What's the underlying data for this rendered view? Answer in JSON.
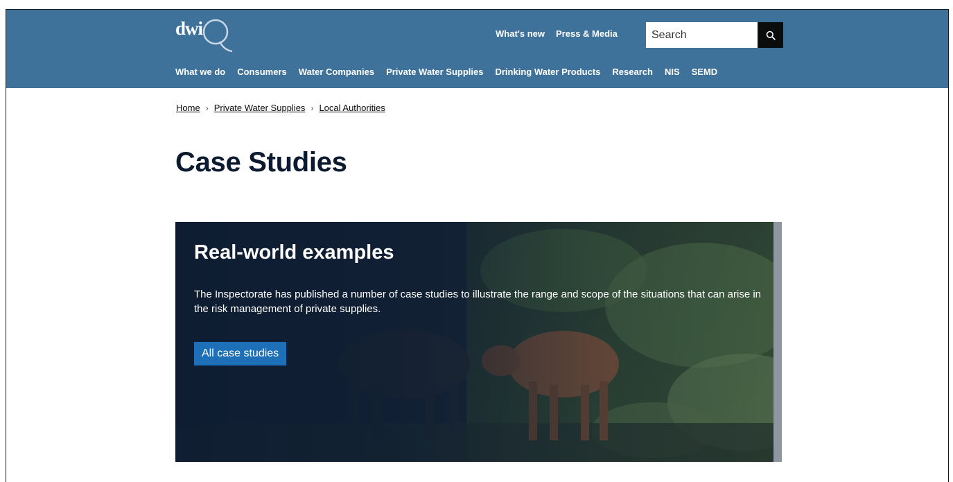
{
  "header": {
    "logo_text": "dwi",
    "utility_nav": [
      {
        "label": "What's new"
      },
      {
        "label": "Press & Media"
      }
    ],
    "search": {
      "placeholder": "Search",
      "icon": "magnifier-icon"
    },
    "main_nav": [
      {
        "label": "What we do"
      },
      {
        "label": "Consumers"
      },
      {
        "label": "Water Companies"
      },
      {
        "label": "Private Water Supplies"
      },
      {
        "label": "Drinking Water Products"
      },
      {
        "label": "Research"
      },
      {
        "label": "NIS"
      },
      {
        "label": "SEMD"
      }
    ],
    "colors": {
      "header_bg": "#3f729b",
      "button_bg": "#1d70b8"
    }
  },
  "breadcrumb": [
    {
      "label": "Home"
    },
    {
      "label": "Private Water Supplies"
    },
    {
      "label": "Local Authorities"
    }
  ],
  "page_title": "Case Studies",
  "hero": {
    "title": "Real-world examples",
    "text": "The Inspectorate has published a number of case studies to illustrate the range and scope of the situations that can arise in the risk management of private supplies.",
    "button_label": "All case studies"
  }
}
